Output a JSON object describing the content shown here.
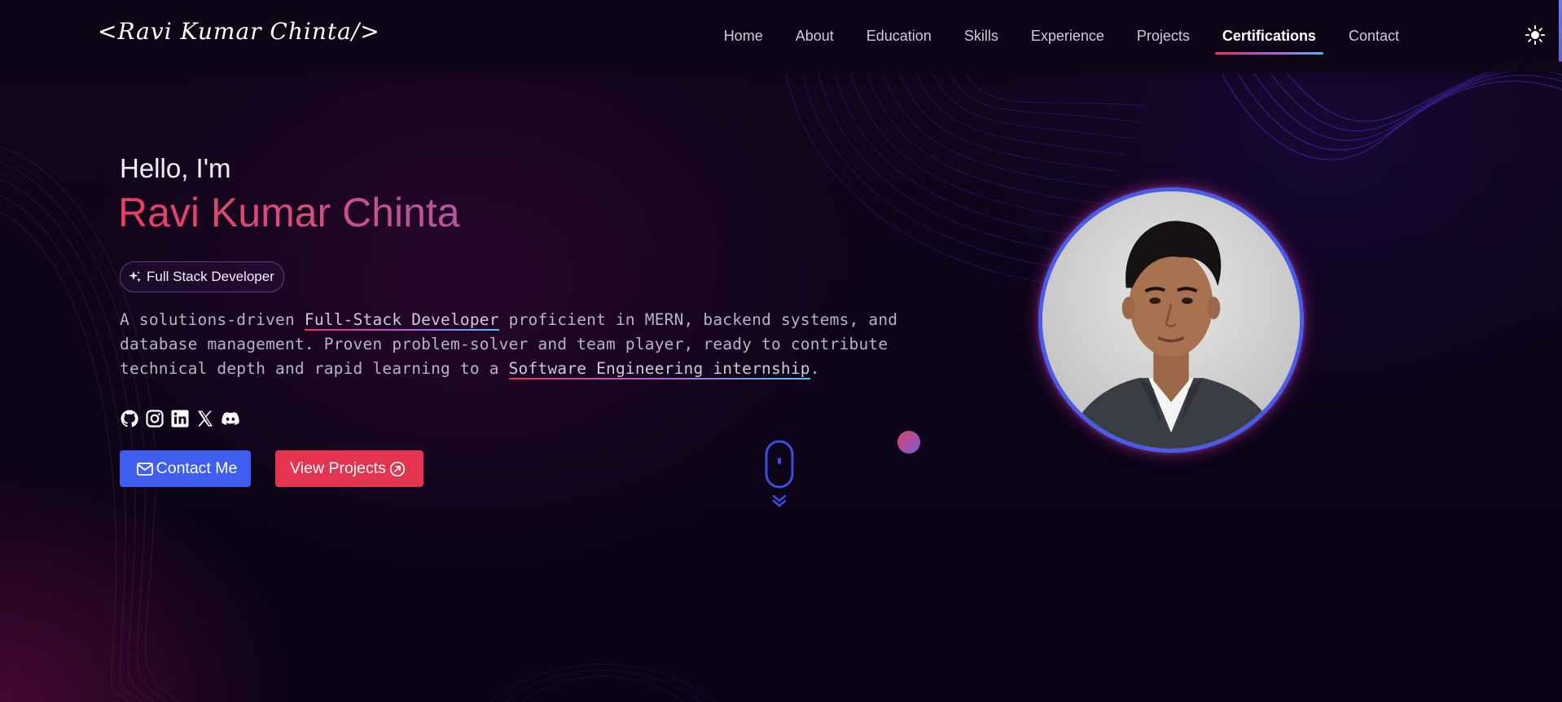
{
  "nav": {
    "logo": "<Ravi Kumar Chinta/>",
    "links": [
      {
        "label": "Home"
      },
      {
        "label": "About"
      },
      {
        "label": "Education"
      },
      {
        "label": "Skills"
      },
      {
        "label": "Experience"
      },
      {
        "label": "Projects"
      },
      {
        "label": "Certifications",
        "active": true
      },
      {
        "label": "Contact"
      }
    ],
    "theme_icon": "sun-icon"
  },
  "hero": {
    "greeting": "Hello, I'm",
    "name": "Ravi Kumar Chinta",
    "role": "Full Stack Developer",
    "description": {
      "part1": "A solutions-driven ",
      "highlight1": "Full-Stack Developer",
      "part2": " proficient in MERN, backend systems, and database management. Proven problem-solver and team player, ready to contribute technical depth and rapid learning to a ",
      "highlight2": "Software Engineering internship",
      "part3": "."
    },
    "socials": [
      "github-icon",
      "instagram-icon",
      "linkedin-icon",
      "x-icon",
      "discord-icon"
    ],
    "buttons": {
      "contact": "Contact Me",
      "projects": "View Projects"
    }
  },
  "colors": {
    "accent_blue": "#3f5ef0",
    "accent_red": "#e3354f",
    "name_gradient_start": "#e83e62",
    "name_gradient_end": "#b257a0"
  }
}
